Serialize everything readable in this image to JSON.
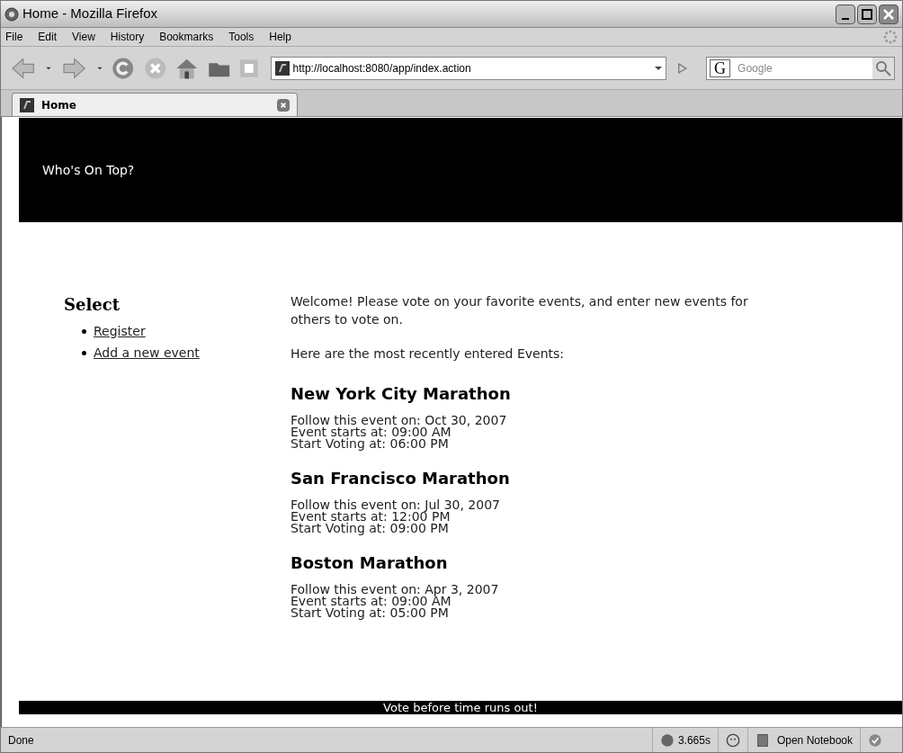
{
  "window": {
    "title": "Home - Mozilla Firefox"
  },
  "menu": [
    "File",
    "Edit",
    "View",
    "History",
    "Bookmarks",
    "Tools",
    "Help"
  ],
  "address": {
    "value": "http://localhost:8080/app/index.action"
  },
  "search": {
    "engine": "G",
    "placeholder": "Google"
  },
  "tabs": [
    {
      "label": "Home",
      "selected": true
    }
  ],
  "page": {
    "header": "Who's On Top?",
    "sidebar": {
      "title": "Select",
      "links": [
        "Register",
        "Add a new event"
      ]
    },
    "intro": "Welcome! Please vote on your favorite events, and enter new events for others to vote on.",
    "recent_label": "Here are the most recently entered Events:",
    "events": [
      {
        "name": "New York City Marathon",
        "lines": [
          "Follow this event on: Oct 30, 2007",
          "Event starts at: 09:00 AM",
          "Start Voting at: 06:00 PM"
        ]
      },
      {
        "name": "San Francisco Marathon",
        "lines": [
          "Follow this event on: Jul 30, 2007",
          "Event starts at: 12:00 PM",
          "Start Voting at: 09:00 PM"
        ]
      },
      {
        "name": "Boston Marathon",
        "lines": [
          "Follow this event on: Apr 3, 2007",
          "Event starts at: 09:00 AM",
          "Start Voting at: 05:00 PM"
        ]
      }
    ],
    "footer": "Vote before time runs out!"
  },
  "status_bar": {
    "text": "Done",
    "timer": "3.665s",
    "notebook": "Open Notebook"
  }
}
